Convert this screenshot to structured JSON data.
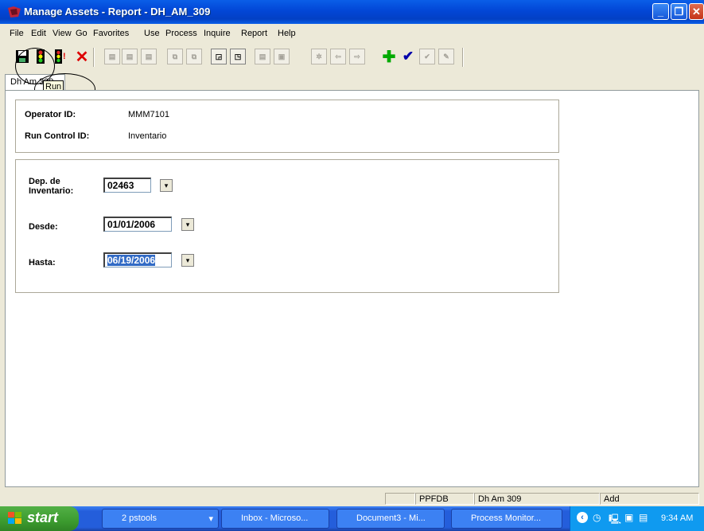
{
  "window": {
    "title": "Manage Assets - Report - DH_AM_309"
  },
  "menu": [
    "File",
    "Edit",
    "View",
    "Go",
    "Favorites",
    "Use",
    "Process",
    "Inquire",
    "Report",
    "Help"
  ],
  "tab": {
    "label": "Dh Am 309"
  },
  "tooltip": {
    "text": "Run"
  },
  "header_panel": {
    "operator_label": "Operator ID:",
    "operator_value": "MMM7101",
    "run_control_label": "Run Control ID:",
    "run_control_value": "Inventario"
  },
  "form": {
    "dep_label_line1": "Dep. de",
    "dep_label_line2": "Inventario:",
    "dep_value": "02463",
    "desde_label": "Desde:",
    "desde_value": "01/01/2006",
    "hasta_label": "Hasta:",
    "hasta_value": "06/19/2006"
  },
  "status": {
    "db": "PPFDB",
    "panel": "Dh Am 309",
    "mode": "Add"
  },
  "taskbar": {
    "start_label": "start",
    "items": [
      "2 pstools",
      "Inbox - Microso...",
      "Document3 - Mi...",
      "Process Monitor..."
    ],
    "clock": "9:34 AM"
  }
}
